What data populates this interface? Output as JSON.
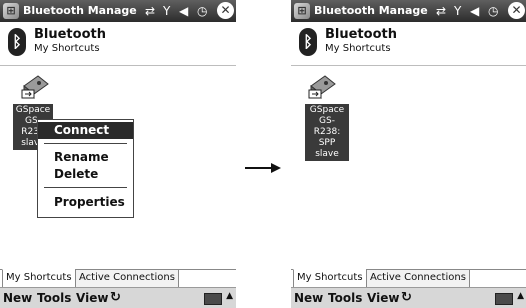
{
  "left": {
    "titlebar": {
      "title": "Bluetooth Manage"
    },
    "header": {
      "title": "Bluetooth",
      "subtitle": "My Shortcuts"
    },
    "device": {
      "label": "GSpace GS-R238 slave"
    },
    "context_menu": {
      "items": [
        "Connect",
        "Rename",
        "Delete",
        "Properties"
      ],
      "selected": "Connect"
    },
    "tabs": [
      "My Shortcuts",
      "Active Connections"
    ],
    "menubar": [
      "New",
      "Tools",
      "View"
    ]
  },
  "right": {
    "titlebar": {
      "title": "Bluetooth Manage"
    },
    "header": {
      "title": "Bluetooth",
      "subtitle": "My Shortcuts"
    },
    "device": {
      "label": "GSpace GS-R238: SPP slave"
    },
    "tabs": [
      "My Shortcuts",
      "Active Connections"
    ],
    "menubar": [
      "New",
      "Tools",
      "View"
    ]
  }
}
